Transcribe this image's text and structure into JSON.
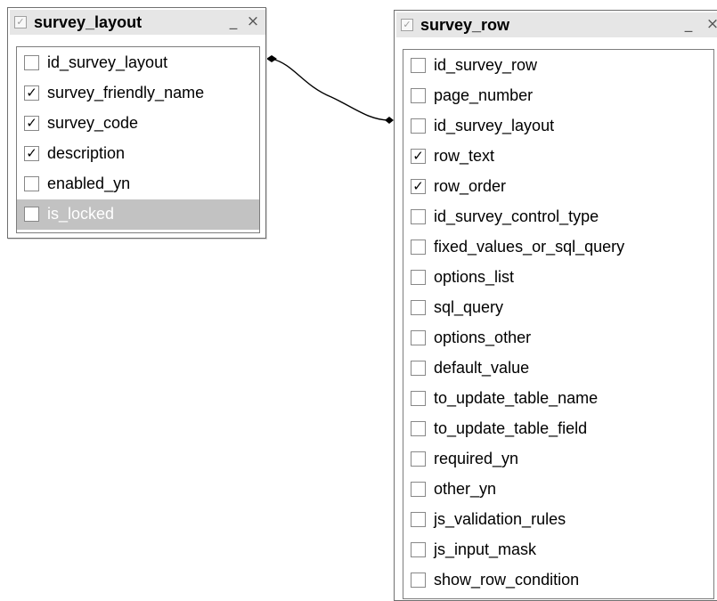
{
  "title_icon": "check-icon",
  "window_controls": {
    "minimize": "_",
    "close": "×"
  },
  "survey_layout": {
    "title": "survey_layout",
    "fields": [
      {
        "name": "id_survey_layout",
        "checked": false,
        "selected": false
      },
      {
        "name": "survey_friendly_name",
        "checked": true,
        "selected": false
      },
      {
        "name": "survey_code",
        "checked": true,
        "selected": false
      },
      {
        "name": "description",
        "checked": true,
        "selected": false
      },
      {
        "name": "enabled_yn",
        "checked": false,
        "selected": false
      },
      {
        "name": "is_locked",
        "checked": false,
        "selected": true
      }
    ]
  },
  "survey_row": {
    "title": "survey_row",
    "fields": [
      {
        "name": "id_survey_row",
        "checked": false
      },
      {
        "name": "page_number",
        "checked": false
      },
      {
        "name": "id_survey_layout",
        "checked": false
      },
      {
        "name": "row_text",
        "checked": true
      },
      {
        "name": "row_order",
        "checked": true
      },
      {
        "name": "id_survey_control_type",
        "checked": false
      },
      {
        "name": "fixed_values_or_sql_query",
        "checked": false
      },
      {
        "name": "options_list",
        "checked": false
      },
      {
        "name": "sql_query",
        "checked": false
      },
      {
        "name": "options_other",
        "checked": false
      },
      {
        "name": "default_value",
        "checked": false
      },
      {
        "name": "to_update_table_name",
        "checked": false
      },
      {
        "name": "to_update_table_field",
        "checked": false
      },
      {
        "name": "required_yn",
        "checked": false
      },
      {
        "name": "other_yn",
        "checked": false
      },
      {
        "name": "js_validation_rules",
        "checked": false
      },
      {
        "name": "js_input_mask",
        "checked": false
      },
      {
        "name": "show_row_condition",
        "checked": false
      }
    ]
  },
  "relationship": {
    "from": "survey_layout.id_survey_layout",
    "to": "survey_row.id_survey_layout"
  }
}
